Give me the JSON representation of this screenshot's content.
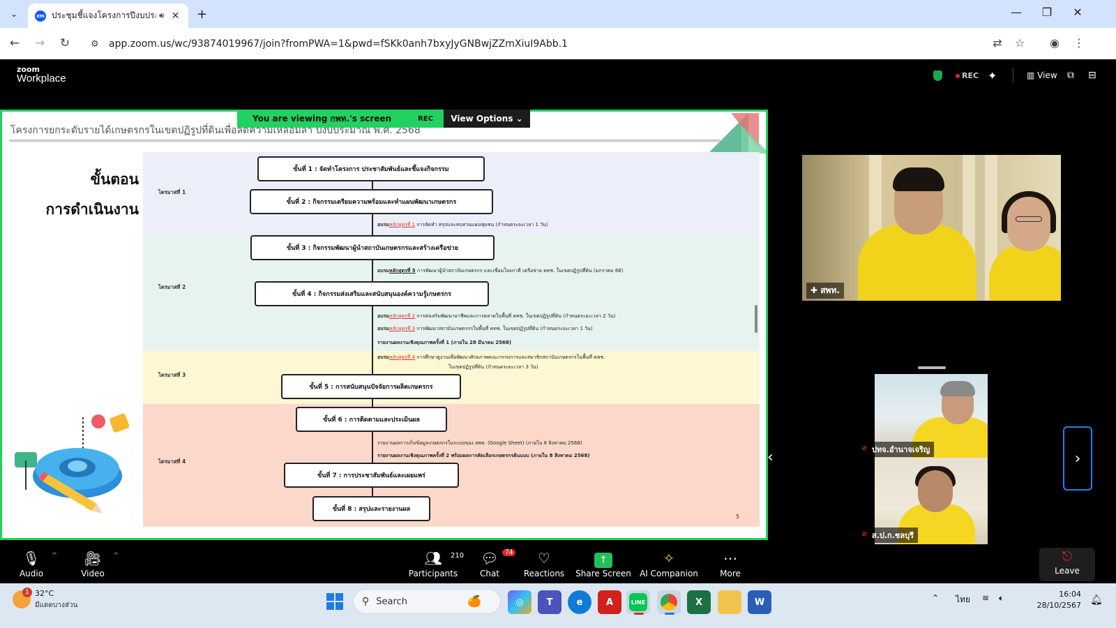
{
  "browser": {
    "tab_title": "ประชุมชี้แจงโครงการปีงบประมาณ",
    "tab_favicon": "zm",
    "url": "app.zoom.us/wc/93874019967/join?fromPWA=1&pwd=fSKk0anh7bxyJyGNBwjZZmXiuI9Abb.1"
  },
  "zoom_header": {
    "logo_top": "zoom",
    "logo_bottom": "Workplace",
    "rec_label": "REC",
    "view_label": "View"
  },
  "share": {
    "viewing_text": "You are viewing  กพท.'s screen",
    "rec_label": "REC",
    "view_options": "View Options"
  },
  "slide": {
    "title": "โครงการยกระดับรายได้เกษตรกรในเขตปฏิรูปที่ดินเพื่อลดความเหลื่อมล้ำ ปีงบประมาณ พ.ศ. 2568",
    "heading_line1": "ขั้นตอน",
    "heading_line2": "การดำเนินงาน",
    "quarters": [
      "ไตรมาสที่ 1",
      "ไตรมาสที่ 2",
      "ไตรมาสที่ 3",
      "ไตรมาสที่ 4"
    ],
    "steps": [
      "ขั้นที่ 1 : จัดทำโครงการ ประชาสัมพันธ์และชี้แจงกิจกรรม",
      "ขั้นที่ 2 : กิจกรรมเตรียมความพร้อมและทำแผนพัฒนาเกษตรกร",
      "ขั้นที่ 3 : กิจกรรมพัฒนาผู้นำสถาบันเกษตรกรและสร้างเครือข่าย",
      "ขั้นที่ 4 : กิจกรรมส่งเสริมและสนับสนุนองค์ความรู้เกษตรกร",
      "ขั้นที่ 5 : การสนับสนุนปัจจัยการผลิตเกษตรกร",
      "ขั้นที่ 6 : การติดตามและประเมินผล",
      "ขั้นที่ 7 : การประชาสัมพันธ์และเผยแพร่",
      "ขั้นที่ 8 : สรุปและรายงานผล"
    ],
    "notes": {
      "n1_prefix": "อบรม",
      "n1_course": "หลักสูตรที่ 1",
      "n1_text": " การจัดทำ สรุปและทบทวนแผนชุมชน (กำหนดระยะเวลา 1 วัน)",
      "n2_prefix": "อบรม",
      "n2_course": "หลักสูตรที่ 5",
      "n2_text": " การพัฒนาผู้นำสถาบันเกษตรกร และเชื่อมโยงภาคี เครือข่าย คทช. ในเขตปฏิรูปที่ดิน (มกราคม 68)",
      "n3_prefix": "อบรม",
      "n3_course": "หลักสูตรที่ 2",
      "n3_text": " การส่งเสริมพัฒนาอาชีพและการตลาดในพื้นที่ คทช. ในเขตปฏิรูปที่ดิน (กำหนดระยะเวลา 2 วัน)",
      "n4_prefix": "อบรม",
      "n4_course": "หลักสูตรที่ 3",
      "n4_text": " การพัฒนาสถาบันเกษตรกรในพื้นที่ คทช. ในเขตปฏิรูปที่ดิน (กำหนดระยะเวลา 1 วัน)",
      "n5": "รายงานผลงานเชิงคุณภาพครั้งที่ 1 (ภายใน 28 มีนาคม 2568)",
      "n6_prefix": "อบรม",
      "n6_course": "หลักสูตรที่ 4",
      "n6_text": " การศึกษาดูงานเพื่อพัฒนาศักยภาพคณะกรรมการและสมาชิกสถาบันเกษตรกรในพื้นที่ คทช.",
      "n6_text2": "ในเขตปฏิรูปที่ดิน (กำหนดระยะเวลา 3 วัน)",
      "n7": "รายงานผลการเก็บข้อมูลเกษตรกรในระบบของ สพท. (Google Sheet) (ภายใน 8 สิงหาคม 2568)",
      "n8": "รายงานผลงานเชิงคุณภาพครั้งที่ 2 พร้อมผลการคัดเลือกเกษตรกรต้นแบบ (ภายใน 8 สิงหาคม 2568)"
    },
    "page_number": "5"
  },
  "participants_video": {
    "speaker_name": "สพท.",
    "thumb1_name": "ปทจ.อำนาจเจริญ",
    "thumb2_name": "ส.ป.ก.ชลบุรี"
  },
  "footer": {
    "audio": "Audio",
    "video": "Video",
    "participants": "Participants",
    "participants_count": "210",
    "chat": "Chat",
    "chat_badge": "74",
    "reactions": "Reactions",
    "share_screen": "Share Screen",
    "ai_companion": "AI Companion",
    "more": "More",
    "leave": "Leave"
  },
  "taskbar": {
    "weather_badge": "1",
    "temperature": "32°C",
    "weather_desc": "มีแดดบางส่วน",
    "search_label": "Search",
    "language": "ไทย",
    "time": "16:04",
    "date": "28/10/2567"
  },
  "colors": {
    "share_border": "#23d160",
    "accent_blue": "#0b5cff",
    "rec_red": "#e02828"
  }
}
